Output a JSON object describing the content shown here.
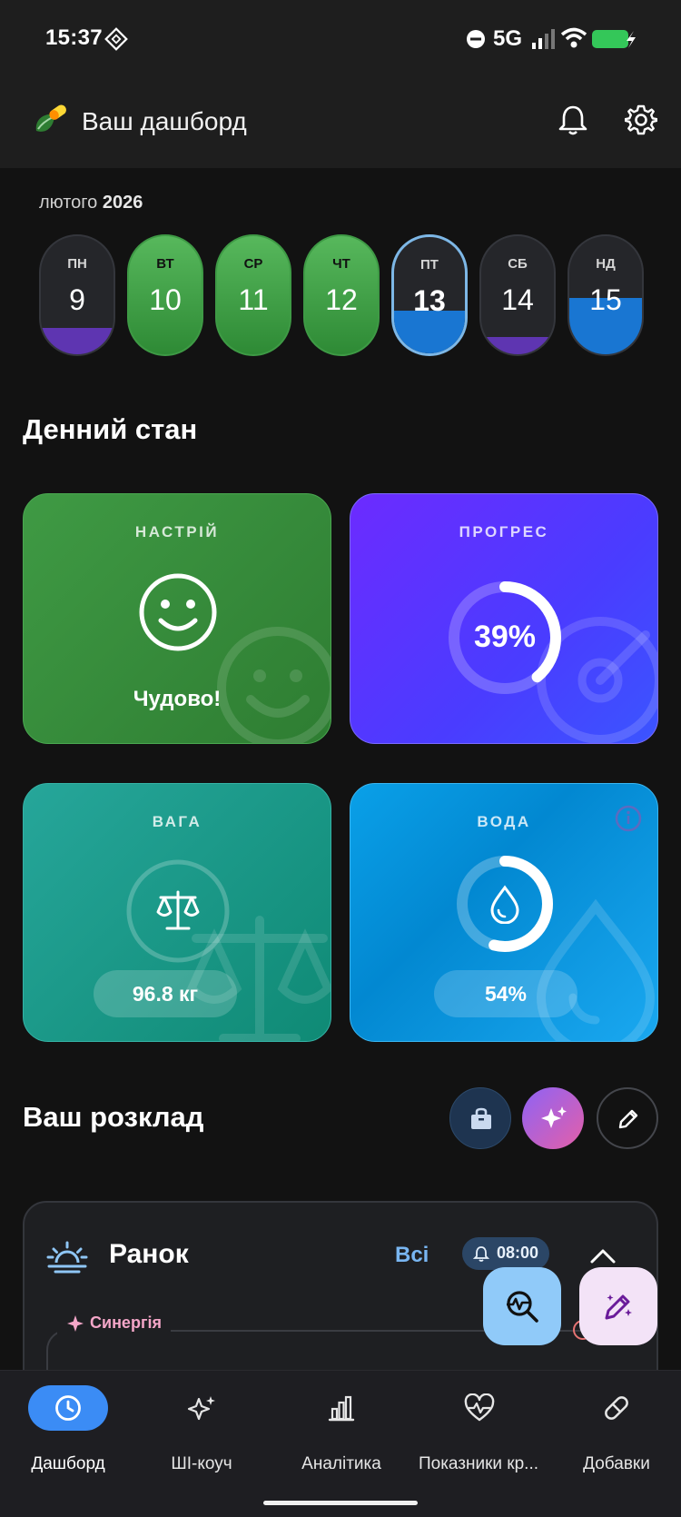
{
  "status_bar": {
    "time": "15:37",
    "network": "5G",
    "battery_color": "#34c759"
  },
  "app_bar": {
    "title": "Ваш дашборд"
  },
  "calendar": {
    "month": "лютого",
    "year": "2026",
    "days": [
      {
        "name": "ПН",
        "date": "9",
        "state": "partial",
        "fill_color": "#5e35b1",
        "fill_fraction": 0.22
      },
      {
        "name": "ВТ",
        "date": "10",
        "state": "complete",
        "fill_fraction": 1.0
      },
      {
        "name": "СР",
        "date": "11",
        "state": "complete",
        "fill_fraction": 1.0
      },
      {
        "name": "ЧТ",
        "date": "12",
        "state": "complete",
        "fill_fraction": 1.0
      },
      {
        "name": "ПТ",
        "date": "13",
        "state": "today",
        "fill_color": "#1976d2",
        "fill_fraction": 0.37
      },
      {
        "name": "СБ",
        "date": "14",
        "state": "partial",
        "fill_color": "#5e35b1",
        "fill_fraction": 0.15
      },
      {
        "name": "НД",
        "date": "15",
        "state": "partial",
        "fill_color": "#1976d2",
        "fill_fraction": 0.48
      }
    ]
  },
  "daily_state": {
    "title": "Денний стан",
    "mood": {
      "label": "НАСТРІЙ",
      "value": "Чудово!"
    },
    "progress": {
      "label": "ПРОГРЕС",
      "percent_text": "39%",
      "percent": 39
    },
    "weight": {
      "label": "ВАГА",
      "value": "96.8 кг"
    },
    "water": {
      "label": "ВОДА",
      "percent_text": "54%",
      "percent": 54
    }
  },
  "schedule": {
    "title": "Ваш розклад",
    "period": "Ранок",
    "all_label": "Всі",
    "time": "08:00",
    "synergy_label": "Синергія"
  },
  "bottom_nav": {
    "items": [
      {
        "label": "Дашборд",
        "icon": "clock-icon",
        "active": true
      },
      {
        "label": "ШІ-коуч",
        "icon": "sparkles-icon",
        "active": false
      },
      {
        "label": "Аналітика",
        "icon": "bar-chart-icon",
        "active": false
      },
      {
        "label": "Показники кр...",
        "icon": "heart-pulse-icon",
        "active": false
      },
      {
        "label": "Добавки",
        "icon": "pill-icon",
        "active": false
      }
    ]
  },
  "colors": {
    "mood_card": "#388e3c",
    "progress_card": "#5b2cff",
    "weight_card": "#1a9a8a",
    "water_card": "#0a9ae6",
    "accent_blue": "#3b8cf5"
  }
}
